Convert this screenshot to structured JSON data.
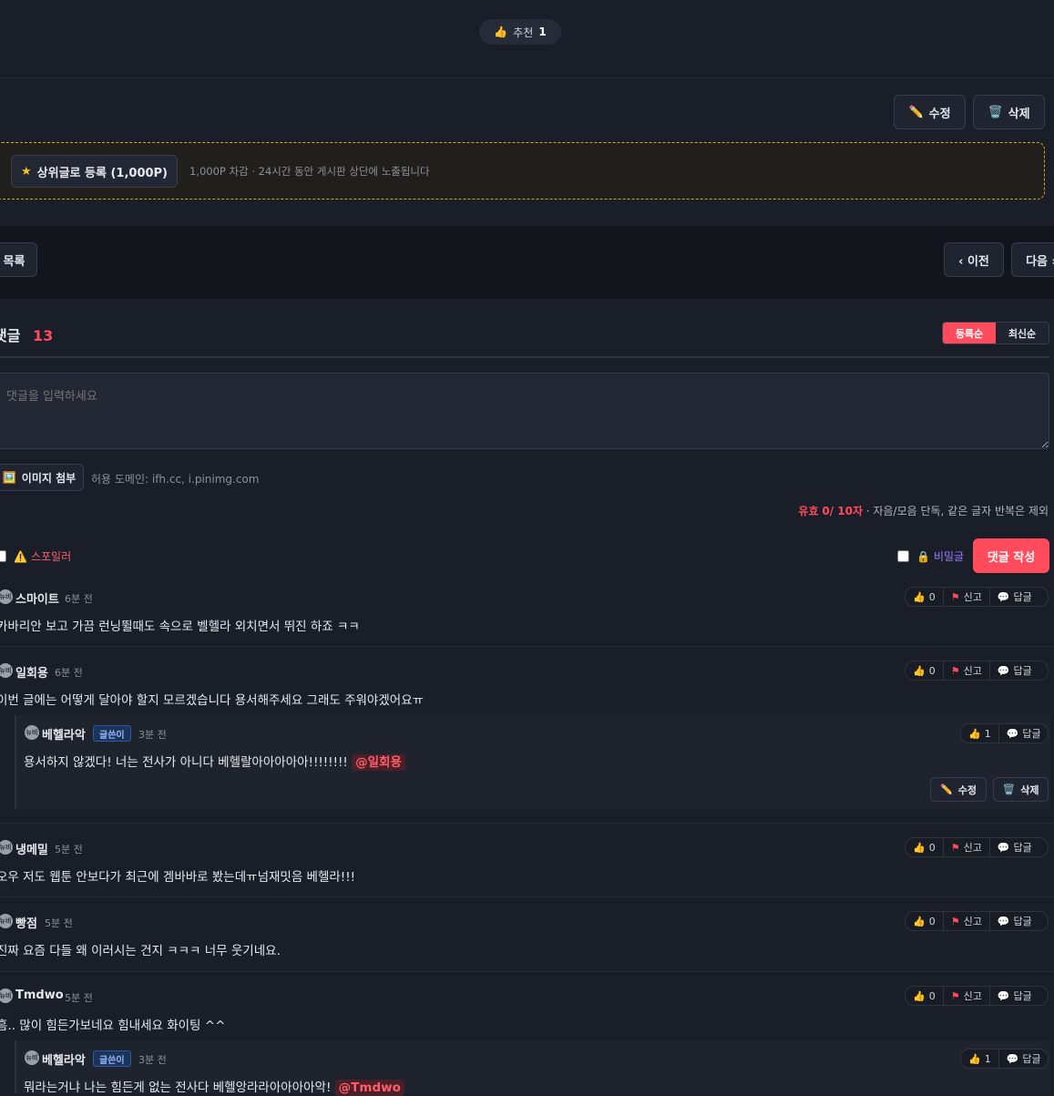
{
  "post": {
    "recommend_label": "추천",
    "recommend_count": "1",
    "edit_label": "수정",
    "delete_label": "삭제",
    "promote_label": "상위글로 등록 (1,000P)",
    "promote_desc": "1,000P 차감 · 24시간 동안 게시판 상단에 노출됩니다"
  },
  "nav": {
    "list_label": "목록",
    "prev_label": "‹ 이전",
    "next_label": "다음 ›"
  },
  "comments_header": {
    "title": "댓글",
    "count": "13",
    "sort_options": [
      "등록순",
      "최신순"
    ],
    "active_sort": "등록순"
  },
  "editor": {
    "placeholder": "댓글을 입력하세요",
    "attach_label": "이미지 첨부",
    "allowed_domains": "허용 도메인: ifh.cc, i.pinimg.com",
    "valid_prefix": "유효",
    "valid_count": "0",
    "valid_max": "/ 10자",
    "valid_note": "· 자음/모음 단독, 같은 글자 반복은 제외",
    "spoiler_label": "스포일러",
    "secret_label": "비밀글",
    "submit_label": "댓글 작성"
  },
  "actions": {
    "report_label": "신고",
    "reply_label": "답글",
    "edit_label": "수정",
    "delete_label": "삭제",
    "author_badge": "글쓴이",
    "avatar_text": "뉴비"
  },
  "comments": [
    {
      "author": "스마이트",
      "time": "6분 전",
      "likes": "0",
      "text": "카바리안 보고 가끔 런닝뛸때도 속으로 벨헬라 외치면서 뛰진 하죠 ㅋㅋ"
    },
    {
      "author": "일회용",
      "time": "6분 전",
      "likes": "0",
      "text": "이번 글에는 어떻게 달아야 할지 모르겠습니다 용서해주세요 그래도 주워야겠어요ㅠ"
    },
    {
      "author": "냉메밀",
      "time": "5분 전",
      "likes": "0",
      "text": "오우 저도 웹툰 안보다가 최근에 겜바바로 봤는데ㅠ넘재밋음 베헬라!!!"
    },
    {
      "author": "빵점",
      "time": "5분 전",
      "likes": "0",
      "text": "진짜 요즘 다들 왜 이러시는 건지 ㅋㅋㅋ 너무 웃기네요."
    },
    {
      "author": "Tmdwo",
      "time": "5분 전",
      "likes": "0",
      "text": "흠.. 많이 힘든가보네요 힘내세요 화이팅 ^^"
    }
  ],
  "replies": [
    {
      "author": "베헬라악",
      "time": "3분 전",
      "likes": "1",
      "text": "용서하지 않겠다! 너는 전사가 아니다 베헬랄아아아아아!!!!!!!!",
      "mention": "@일회용"
    },
    {
      "author": "베헬라악",
      "time": "3분 전",
      "likes": "1",
      "text": "뭐라는거냐 나는 힘든게 없는 전사다 베헬앙라라아아아아악!",
      "mention": "@Tmdwo"
    }
  ],
  "colors": {
    "accent": "#ff4b5c",
    "background": "#1a1e28",
    "badge_blue": "#1d3358",
    "promo_border": "#d4a62a"
  }
}
